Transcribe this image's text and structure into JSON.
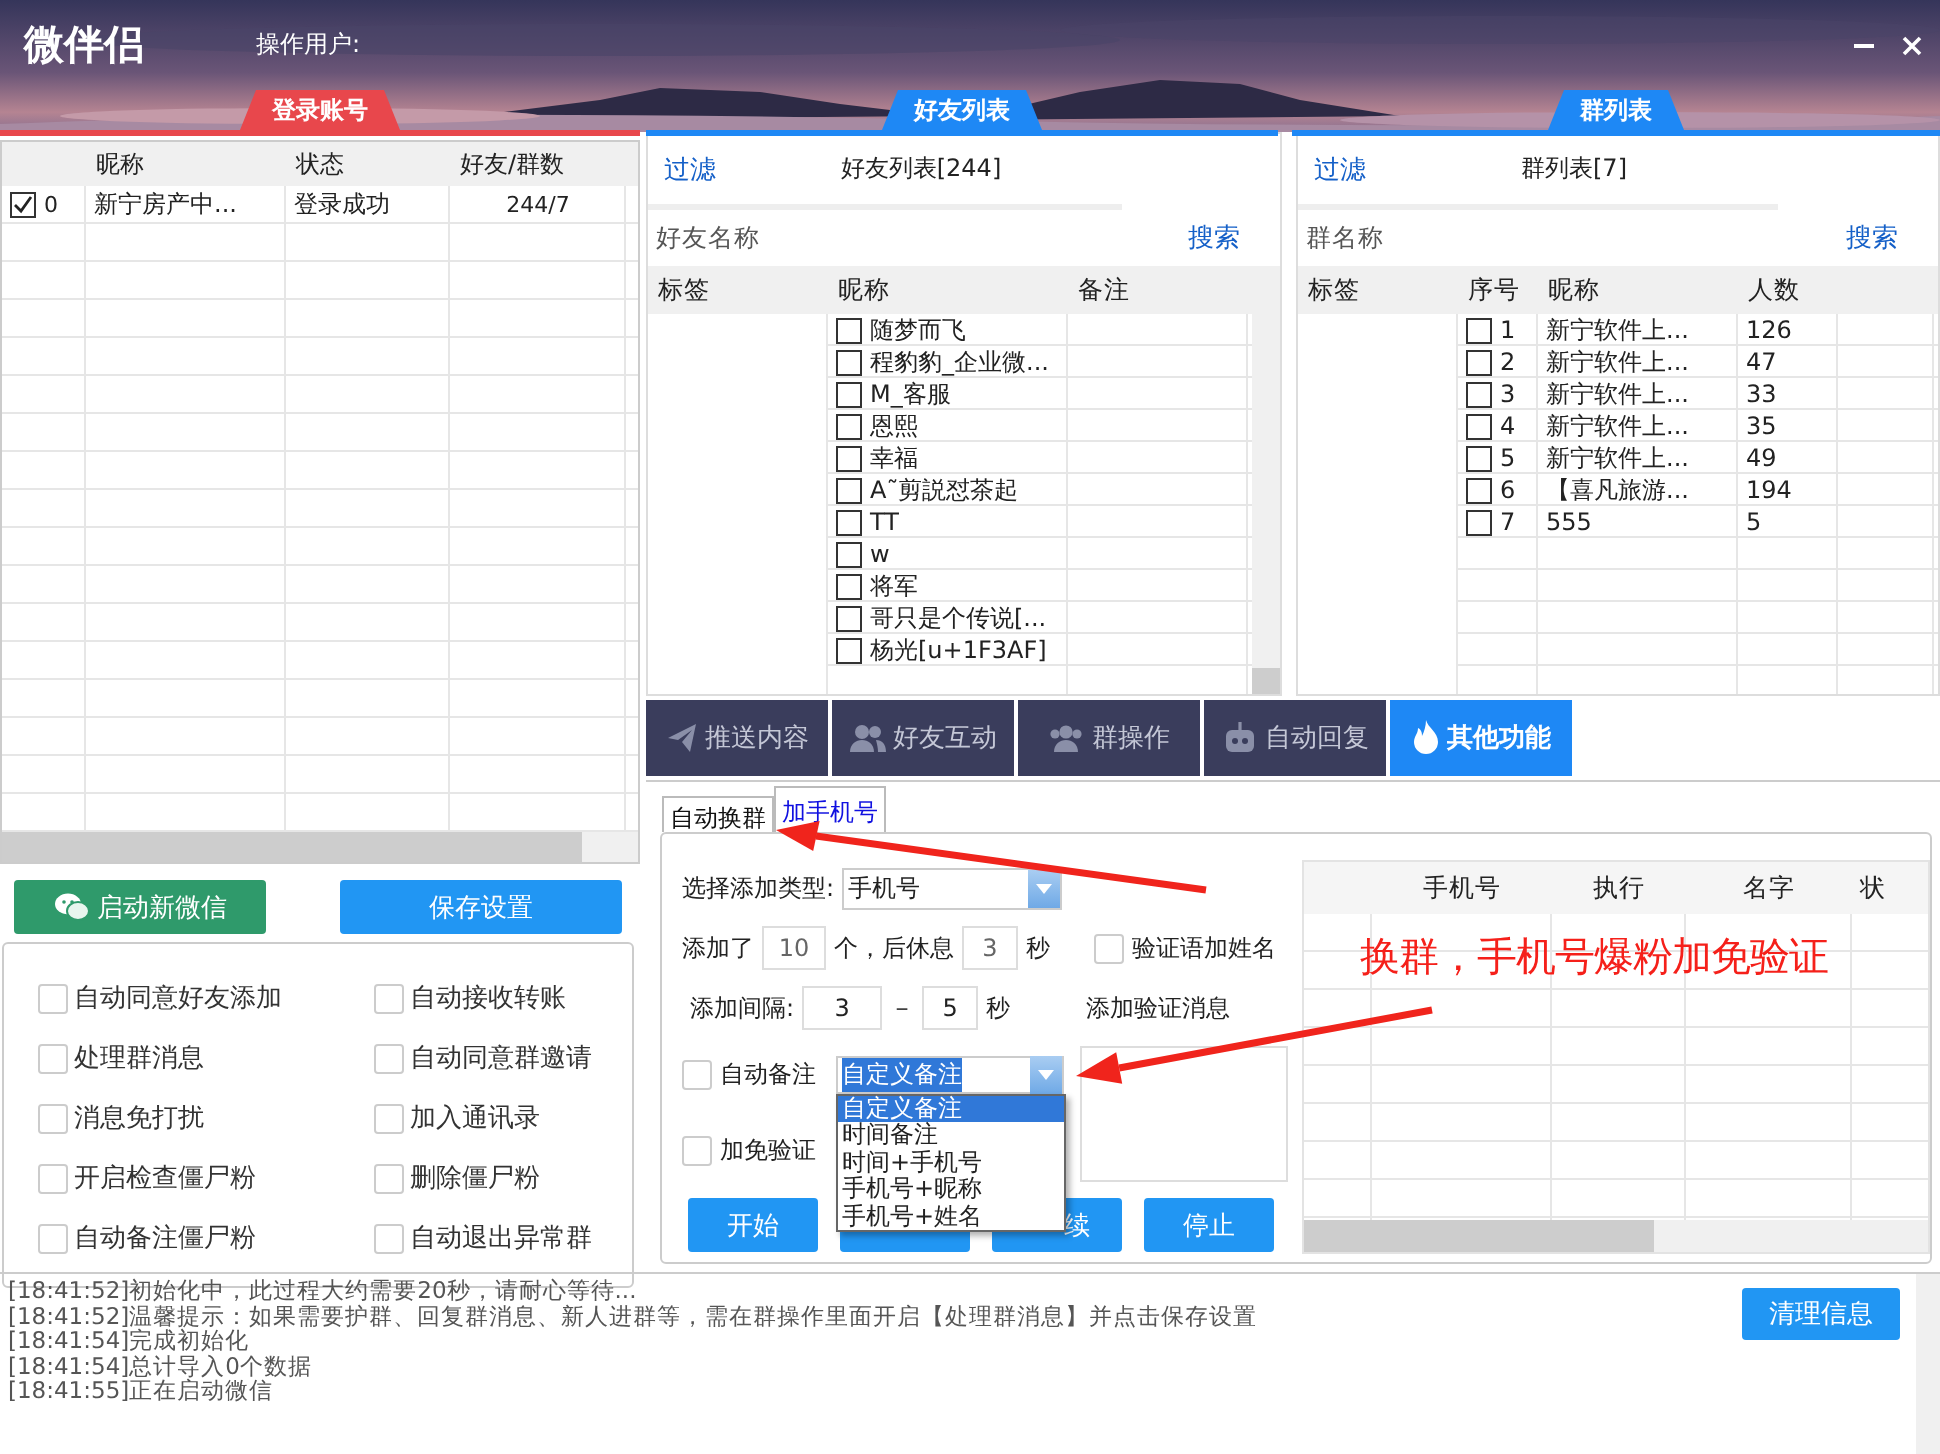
{
  "app": {
    "title": "微伴侣",
    "operator_label": "操作用户:"
  },
  "section_tabs": [
    {
      "label": "登录账号",
      "color": "#e8474c"
    },
    {
      "label": "好友列表",
      "color": "#1e88f5"
    },
    {
      "label": "群列表",
      "color": "#1e88f5"
    }
  ],
  "accounts": {
    "columns": [
      "昵称",
      "状态",
      "好友/群数"
    ],
    "rows": [
      {
        "checked": true,
        "index": "0",
        "nickname": "新宁房产中...",
        "status": "登录成功",
        "counts": "244/7"
      }
    ]
  },
  "left_buttons": {
    "start_wechat": "启动新微信",
    "save": "保存设置"
  },
  "options": [
    {
      "label": "自动同意好友添加",
      "checked": false
    },
    {
      "label": "自动接收转账",
      "checked": false
    },
    {
      "label": "处理群消息",
      "checked": false
    },
    {
      "label": "自动同意群邀请",
      "checked": false
    },
    {
      "label": "消息免打扰",
      "checked": false
    },
    {
      "label": "加入通讯录",
      "checked": false
    },
    {
      "label": "开启检查僵尸粉",
      "checked": false
    },
    {
      "label": "删除僵尸粉",
      "checked": false
    },
    {
      "label": "自动备注僵尸粉",
      "checked": false
    },
    {
      "label": "自动退出异常群",
      "checked": false
    }
  ],
  "friends": {
    "filter": "过滤",
    "title": "好友列表[244]",
    "placeholder": "好友名称",
    "search": "搜索",
    "columns": [
      "标签",
      "昵称",
      "备注"
    ],
    "rows": [
      {
        "checked": false,
        "nickname": "随梦而飞"
      },
      {
        "checked": false,
        "nickname": "程豹豹_企业微..."
      },
      {
        "checked": false,
        "nickname": "M_客服"
      },
      {
        "checked": false,
        "nickname": "恩熙"
      },
      {
        "checked": false,
        "nickname": "幸福"
      },
      {
        "checked": false,
        "nickname": "A˜剪説怼茶起"
      },
      {
        "checked": false,
        "nickname": "TT"
      },
      {
        "checked": false,
        "nickname": "w"
      },
      {
        "checked": false,
        "nickname": "将军"
      },
      {
        "checked": false,
        "nickname": "哥只是个传说[..."
      },
      {
        "checked": false,
        "nickname": "杨光[u+1F3AF]"
      }
    ]
  },
  "groups": {
    "filter": "过滤",
    "title": "群列表[7]",
    "placeholder": "群名称",
    "search": "搜索",
    "columns": [
      "标签",
      "序号",
      "昵称",
      "人数"
    ],
    "rows": [
      {
        "checked": false,
        "index": "1",
        "name": "新宁软件上...",
        "members": "126"
      },
      {
        "checked": false,
        "index": "2",
        "name": "新宁软件上...",
        "members": "47"
      },
      {
        "checked": false,
        "index": "3",
        "name": "新宁软件上...",
        "members": "33"
      },
      {
        "checked": false,
        "index": "4",
        "name": "新宁软件上...",
        "members": "35"
      },
      {
        "checked": false,
        "index": "5",
        "name": "新宁软件上...",
        "members": "49"
      },
      {
        "checked": false,
        "index": "6",
        "name": "【喜凡旅游...",
        "members": "194"
      },
      {
        "checked": false,
        "index": "7",
        "name": "555",
        "members": "5"
      }
    ]
  },
  "function_tabs": [
    {
      "label": "推送内容",
      "selected": false
    },
    {
      "label": "好友互动",
      "selected": false
    },
    {
      "label": "群操作",
      "selected": false
    },
    {
      "label": "自动回复",
      "selected": false
    },
    {
      "label": "其他功能",
      "selected": true
    }
  ],
  "sub_tabs": [
    {
      "label": "自动换群",
      "selected": false
    },
    {
      "label": "加手机号",
      "selected": true
    }
  ],
  "form": {
    "type_label": "选择添加类型:",
    "type_value": "手机号",
    "added_label": "添加了",
    "added_value": "10",
    "rest_label": "个，后休息",
    "rest_value": "3",
    "rest_unit": "秒",
    "name_check": {
      "label": "验证语加姓名",
      "checked": false
    },
    "interval_label": "添加间隔:",
    "interval_min": "3",
    "interval_dash": "－",
    "interval_max": "5",
    "interval_unit": "秒",
    "verify_label": "添加验证消息",
    "auto_remark": {
      "label": "自动备注",
      "checked": false
    },
    "remark_value": "自定义备注",
    "remark_options": [
      {
        "label": "自定义备注",
        "selected": true
      },
      {
        "label": "时间备注",
        "selected": false
      },
      {
        "label": "时间+手机号",
        "selected": false
      },
      {
        "label": "手机号+昵称",
        "selected": false
      },
      {
        "label": "手机号+姓名",
        "selected": false
      }
    ],
    "no_verify": {
      "label": "加免验证",
      "checked": false
    },
    "buttons": [
      {
        "kind": "full",
        "label": "开始"
      },
      {
        "kind": "covered"
      },
      {
        "kind": "partly_covered",
        "label": "续"
      },
      {
        "kind": "full",
        "label": "停止"
      }
    ]
  },
  "phone_table": {
    "columns": [
      "手机号",
      "执行",
      "名字",
      "状"
    ]
  },
  "annotation": "换群，手机号爆粉加免验证",
  "log": {
    "lines": [
      "[18:41:52]初始化中，此过程大约需要20秒，请耐心等待...",
      "[18:41:52]温馨提示：如果需要护群、回复群消息、新人进群等，需在群操作里面开启【处理群消息】并点击保存设置",
      "[18:41:54]完成初始化",
      "[18:41:54]总计导入0个数据",
      "[18:41:55]正在启动微信"
    ],
    "clear": "清理信息"
  }
}
